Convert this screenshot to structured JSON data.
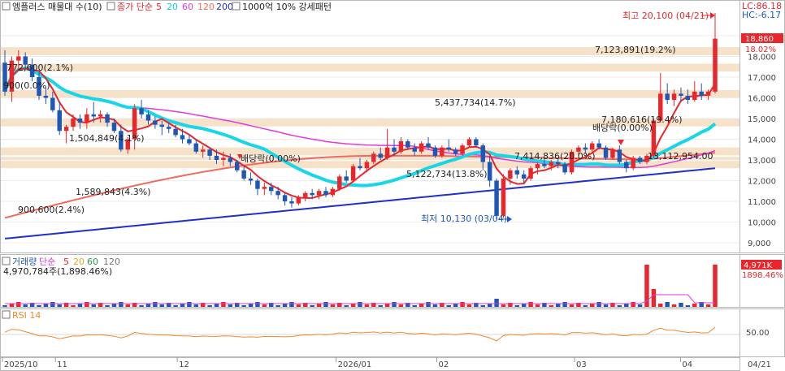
{
  "header": {
    "title": "엠플러스 매물대 수(10)",
    "price_label": "종가 단순",
    "ma_periods": [
      "5",
      "20",
      "60",
      "120",
      "200"
    ],
    "vol_profile_label": "1000억 10% 강세패턴"
  },
  "corner": {
    "lc": "LC:86.18",
    "hc": "HC:-6.17"
  },
  "price_axis": {
    "ticks": [
      "19,000",
      "18,000",
      "17,000",
      "16,000",
      "15,000",
      "14,000",
      "13,000",
      "12,000",
      "11,000",
      "10,000",
      "9,000"
    ],
    "current": "18,860",
    "current_pct": "18.02%"
  },
  "annotations": {
    "high": "최고 20,100 (04/21)",
    "low": "최저 10,130 (03/04)",
    "dividend1": "배당락(0.00%)",
    "dividend2": "배당락(0.00%)"
  },
  "volume_profile": [
    {
      "label": "7,123,891(19.2%)"
    },
    {
      "label": "772,600(2.1%)"
    },
    {
      "label": "900(0.0%)"
    },
    {
      "label": "5,437,734(14.7%)"
    },
    {
      "label": "7,180,616(19.4%)"
    },
    {
      "label": "1,504,849(4.1%)"
    },
    {
      "label": "7,414,836(20.0%)"
    },
    {
      "label": "5,122,734(13.8%)"
    },
    {
      "label": "1,589,843(4.3%)"
    },
    {
      "label": "900,600(2.4%)"
    },
    {
      "label": "13,112,954.00"
    }
  ],
  "volume_panel": {
    "title": "거래량",
    "ma_label": "단순",
    "ma_periods": [
      "5",
      "20",
      "60",
      "120"
    ],
    "summary": "4,970,784주(1,898.46%)",
    "current": "4,971K",
    "current_pct": "1898.46%"
  },
  "rsi_panel": {
    "title": "RSI 14",
    "tick": "50.00"
  },
  "date_axis": {
    "labels": [
      "2025/10",
      "11",
      "12",
      "2026/01",
      "02",
      "03",
      "04"
    ],
    "current": "04/21"
  },
  "colors": {
    "up": "#e8262b",
    "down": "#1f57b7",
    "ma5": "#e8262b",
    "ma20": "#18d6e8",
    "ma60": "#e23ad8",
    "ma120": "#ef6b5e",
    "ma200": "#2030c8",
    "band": "#f4dcc0",
    "rsi": "#f08a2c"
  },
  "chart_data": {
    "type": "candlestick",
    "title": "엠플러스 매물대 수(10)",
    "ylim": [
      9000,
      20500
    ],
    "high": {
      "date": "04/21",
      "value": 20100
    },
    "low": {
      "date": "03/04",
      "value": 10130
    },
    "last_close": 18860,
    "candles": [
      [
        17700,
        18300,
        16100,
        16300
      ],
      [
        16300,
        18000,
        15800,
        17800
      ],
      [
        17800,
        18300,
        17400,
        18000
      ],
      [
        18000,
        18200,
        17400,
        17600
      ],
      [
        17600,
        17900,
        16800,
        17000
      ],
      [
        17000,
        17300,
        15900,
        16100
      ],
      [
        16100,
        16500,
        15700,
        16000
      ],
      [
        16000,
        16300,
        15300,
        15400
      ],
      [
        15400,
        15800,
        14200,
        14400
      ],
      [
        14400,
        14700,
        13800,
        14600
      ],
      [
        14600,
        15200,
        14400,
        15000
      ],
      [
        15000,
        15200,
        14500,
        14800
      ],
      [
        14800,
        15500,
        14500,
        15200
      ],
      [
        15200,
        15800,
        14800,
        15100
      ],
      [
        15100,
        15400,
        14800,
        15200
      ],
      [
        15200,
        15300,
        14600,
        14800
      ],
      [
        14800,
        15000,
        14300,
        14400
      ],
      [
        14400,
        14700,
        13400,
        13500
      ],
      [
        13500,
        14100,
        13300,
        14000
      ],
      [
        14000,
        15700,
        13500,
        15500
      ],
      [
        15500,
        15900,
        15000,
        15200
      ],
      [
        15200,
        15400,
        14700,
        14900
      ],
      [
        14900,
        15100,
        14500,
        14700
      ],
      [
        14700,
        14900,
        14200,
        14600
      ],
      [
        14600,
        14800,
        14300,
        14500
      ],
      [
        14500,
        14700,
        14100,
        14200
      ],
      [
        14200,
        14500,
        13800,
        14000
      ],
      [
        14000,
        14200,
        13700,
        13800
      ],
      [
        13800,
        14000,
        13300,
        13400
      ],
      [
        13400,
        13700,
        13100,
        13500
      ],
      [
        13500,
        13600,
        13000,
        13200
      ],
      [
        13200,
        13500,
        12800,
        13000
      ],
      [
        13000,
        13400,
        12700,
        13100
      ],
      [
        13100,
        13300,
        12700,
        12900
      ],
      [
        12900,
        13000,
        12400,
        12500
      ],
      [
        12500,
        12700,
        12000,
        12100
      ],
      [
        12100,
        12400,
        11800,
        12000
      ],
      [
        12000,
        12100,
        11300,
        11600
      ],
      [
        11600,
        11900,
        11300,
        11700
      ],
      [
        11700,
        11900,
        11300,
        11500
      ],
      [
        11500,
        11700,
        11100,
        11300
      ],
      [
        11300,
        11400,
        10800,
        11000
      ],
      [
        11000,
        11200,
        10700,
        10900
      ],
      [
        10900,
        11300,
        10800,
        11200
      ],
      [
        11200,
        11500,
        11000,
        11400
      ],
      [
        11400,
        11600,
        11100,
        11300
      ],
      [
        11300,
        11600,
        11100,
        11500
      ],
      [
        11500,
        11700,
        11200,
        11300
      ],
      [
        11300,
        11700,
        11200,
        11600
      ],
      [
        11600,
        12300,
        11500,
        12200
      ],
      [
        12200,
        12500,
        11900,
        12000
      ],
      [
        12000,
        12800,
        11900,
        12700
      ],
      [
        12700,
        13100,
        12500,
        12600
      ],
      [
        12600,
        13000,
        12400,
        12900
      ],
      [
        12900,
        13400,
        12800,
        13300
      ],
      [
        13300,
        13600,
        13000,
        13100
      ],
      [
        13100,
        14500,
        13000,
        13600
      ],
      [
        13600,
        14000,
        13200,
        13400
      ],
      [
        13400,
        14100,
        13300,
        13900
      ],
      [
        13900,
        14000,
        13500,
        13600
      ],
      [
        13600,
        13800,
        13200,
        13400
      ],
      [
        13400,
        13900,
        13300,
        13800
      ],
      [
        13800,
        14100,
        13500,
        13600
      ],
      [
        13600,
        13700,
        13100,
        13200
      ],
      [
        13200,
        13700,
        13100,
        13600
      ],
      [
        13600,
        14000,
        13400,
        13500
      ],
      [
        13500,
        13600,
        13200,
        13300
      ],
      [
        13300,
        13800,
        13200,
        13700
      ],
      [
        13700,
        14100,
        13600,
        14000
      ],
      [
        14000,
        14100,
        13600,
        13700
      ],
      [
        13700,
        13800,
        12500,
        12900
      ],
      [
        12900,
        13200,
        11700,
        12000
      ],
      [
        12000,
        12100,
        10130,
        10300
      ],
      [
        10300,
        12300,
        10200,
        12100
      ],
      [
        12100,
        12600,
        11800,
        12500
      ],
      [
        12500,
        12700,
        12100,
        12300
      ],
      [
        12300,
        12500,
        11900,
        12100
      ],
      [
        12100,
        12700,
        12000,
        12600
      ],
      [
        12600,
        12900,
        12300,
        12800
      ],
      [
        12800,
        13100,
        12600,
        12700
      ],
      [
        12700,
        13000,
        12500,
        12900
      ],
      [
        12900,
        13100,
        12600,
        12800
      ],
      [
        12800,
        12900,
        12300,
        12400
      ],
      [
        12400,
        13500,
        12300,
        13400
      ],
      [
        13400,
        13700,
        13200,
        13600
      ],
      [
        13600,
        13800,
        13300,
        13500
      ],
      [
        13500,
        13900,
        13400,
        13800
      ],
      [
        13800,
        14000,
        13500,
        13600
      ],
      [
        13600,
        13700,
        13000,
        13100
      ],
      [
        13100,
        13600,
        13000,
        13500
      ],
      [
        13500,
        13700,
        12800,
        12900
      ],
      [
        12900,
        13000,
        12400,
        12600
      ],
      [
        12600,
        13200,
        12500,
        13100
      ],
      [
        13100,
        13200,
        12800,
        12900
      ],
      [
        12900,
        13300,
        12800,
        13200
      ],
      [
        13200,
        15000,
        13100,
        14900
      ],
      [
        14900,
        17200,
        14800,
        16200
      ],
      [
        16200,
        16700,
        15700,
        15900
      ],
      [
        15900,
        16400,
        15600,
        16200
      ],
      [
        16200,
        16500,
        15800,
        16100
      ],
      [
        16100,
        16400,
        15700,
        15900
      ],
      [
        15900,
        16800,
        15800,
        16300
      ],
      [
        16300,
        16700,
        15900,
        16100
      ],
      [
        16100,
        16400,
        15900,
        16300
      ],
      [
        16300,
        20100,
        16200,
        18860
      ]
    ],
    "rsi_reference": 50
  }
}
